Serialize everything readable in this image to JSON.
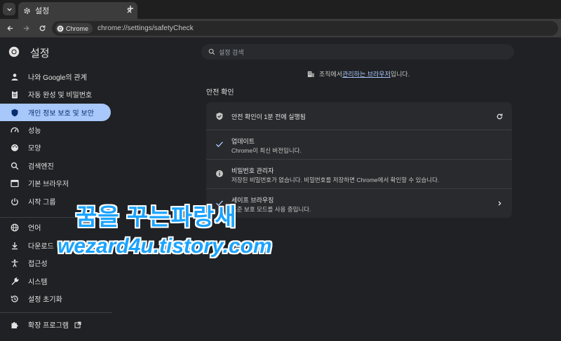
{
  "browser": {
    "tab_title": "설정",
    "omnibox_chip": "Chrome",
    "url": "chrome://settings/safetyCheck"
  },
  "header": {
    "title": "설정",
    "search_placeholder": "설정 검색"
  },
  "sidebar": {
    "items": [
      {
        "label": "나와 Google의 관계",
        "icon": "person-icon"
      },
      {
        "label": "자동 완성 및 비밀번호",
        "icon": "clipboard-icon"
      },
      {
        "label": "개인 정보 보호 및 보안",
        "icon": "shield-icon",
        "active": true
      },
      {
        "label": "성능",
        "icon": "speedometer-icon"
      },
      {
        "label": "모양",
        "icon": "palette-icon"
      },
      {
        "label": "검색엔진",
        "icon": "search-icon"
      },
      {
        "label": "기본 브라우저",
        "icon": "browser-icon"
      },
      {
        "label": "시작 그룹",
        "icon": "power-icon"
      },
      {
        "label": "언어",
        "icon": "globe-icon"
      },
      {
        "label": "다운로드",
        "icon": "download-icon"
      },
      {
        "label": "접근성",
        "icon": "accessibility-icon"
      },
      {
        "label": "시스템",
        "icon": "wrench-icon"
      },
      {
        "label": "설정 초기화",
        "icon": "reset-icon"
      },
      {
        "label": "확장 프로그램",
        "icon": "puzzle-icon"
      }
    ]
  },
  "main": {
    "managed_prefix": "조직에서 ",
    "managed_link": "관리하는 브라우저",
    "managed_suffix": "입니다.",
    "section_title": "안전 확인",
    "safety": {
      "header": "안전 확인이 1분 전에 실행됨",
      "rows": [
        {
          "title": "업데이트",
          "subtitle": "Chrome이 최신 버전입니다.",
          "icon": "check-icon"
        },
        {
          "title": "비밀번호 관리자",
          "subtitle": "저장된 비밀번호가 없습니다. 비밀번호를 저장하면 Chrome에서 확인할 수 있습니다.",
          "icon": "info-icon"
        },
        {
          "title": "세이프 브라우징",
          "subtitle": "표준 보호 모드를 사용 중입니다.",
          "icon": "check-icon"
        }
      ]
    }
  },
  "watermark": {
    "line1": "꿈을 꾸는파랑새",
    "line2": "wezard4u.tistory.com"
  },
  "colors": {
    "accent": "#a8c7fa",
    "background": "#202124",
    "card": "#282a2d",
    "watermark": "#1aa3ff"
  }
}
